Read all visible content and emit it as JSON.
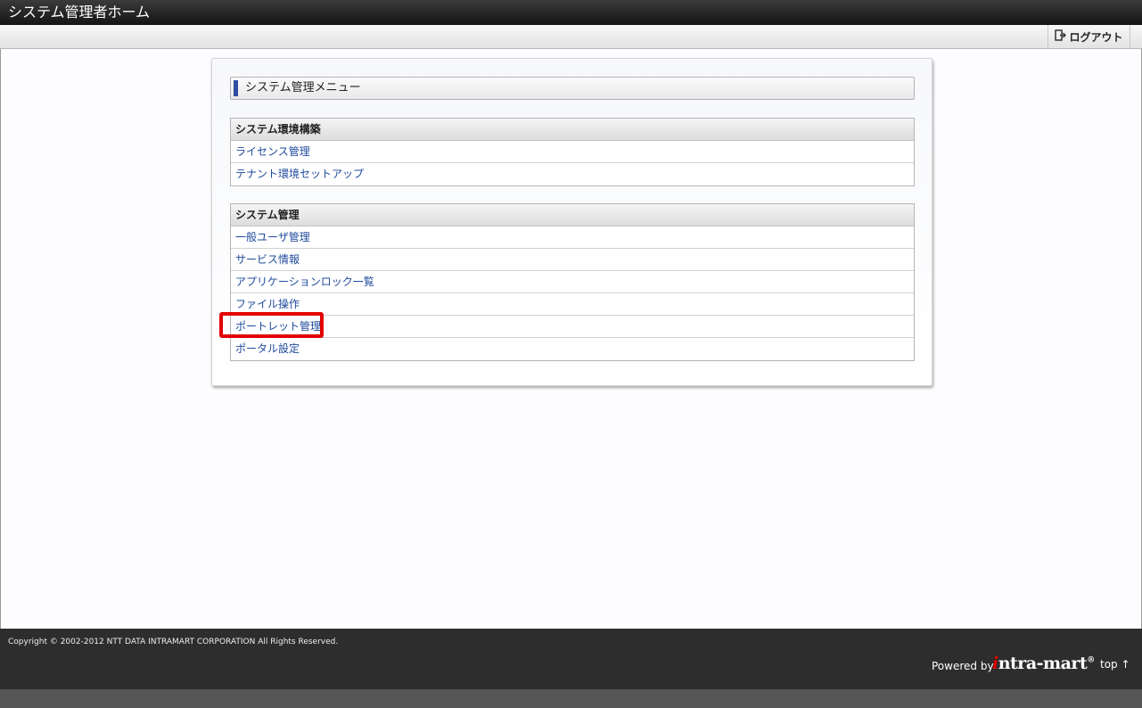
{
  "header": {
    "title": "システム管理者ホーム"
  },
  "toolbar": {
    "logout_label": "ログアウト",
    "logout_icon": "logout-icon"
  },
  "panel": {
    "title": "システム管理メニュー",
    "groups": [
      {
        "header": "システム環境構築",
        "items": [
          "ライセンス管理",
          "テナント環境セットアップ"
        ]
      },
      {
        "header": "システム管理",
        "items": [
          "一般ユーザ管理",
          "サービス情報",
          "アプリケーションロック一覧",
          "ファイル操作",
          "ポートレット管理",
          "ポータル設定"
        ]
      }
    ]
  },
  "highlight": {
    "target": "ポートレット管理",
    "color": "#e10000"
  },
  "footer": {
    "copyright": "Copyright © 2002-2012 NTT DATA INTRAMART CORPORATION All Rights Reserved.",
    "powered_by": "Powered by",
    "logo_i": "i",
    "logo_rest": "ntra-mart",
    "logo_mark": "®",
    "top_label": "top ↑"
  },
  "colors": {
    "accent": "#2f4da3",
    "link": "#1f4a9c",
    "footer_bg": "#2d2d2d"
  }
}
